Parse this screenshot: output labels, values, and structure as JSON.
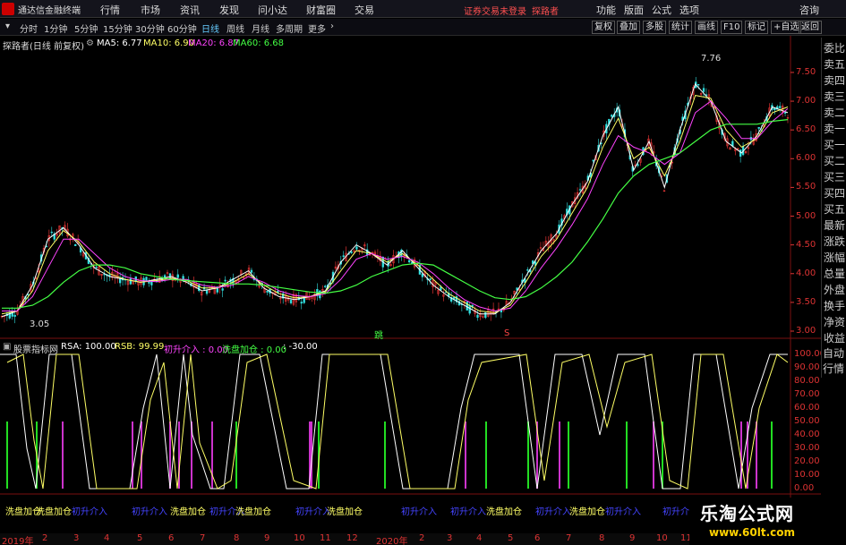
{
  "menubar": {
    "app_title": "通达信金融终端",
    "items": [
      "行情",
      "市场",
      "资讯",
      "发现",
      "问小达",
      "财富圈",
      "交易"
    ],
    "notice": "证券交易未登录",
    "user": "探路者",
    "right_items": [
      "功能",
      "版面",
      "公式",
      "选项",
      "咨询"
    ]
  },
  "toolbar": {
    "periods": [
      "分时",
      "1分钟",
      "5分钟",
      "15分钟",
      "30分钟",
      "60分钟",
      "日线",
      "周线",
      "月线",
      "多周期",
      "更多"
    ],
    "active_period": "日线",
    "right_buttons": [
      "复权",
      "叠加",
      "多股",
      "统计",
      "画线",
      "F10",
      "标记",
      "+自选",
      "返回"
    ]
  },
  "main_chart": {
    "title": "探路者(日线 前复权)",
    "ma": [
      {
        "label": "MA5: 6.77",
        "color": "#ffffff"
      },
      {
        "label": "MA10: 6.90",
        "color": "#ffff66"
      },
      {
        "label": "MA20: 6.87",
        "color": "#ff44ff"
      },
      {
        "label": "MA60: 6.68",
        "color": "#44ff44"
      }
    ],
    "y_ticks": [
      "7.50",
      "7.00",
      "6.50",
      "6.00",
      "5.50",
      "5.00",
      "4.50",
      "4.00",
      "3.50",
      "3.00"
    ],
    "high_label": "7.76",
    "low_label": "3.05",
    "marker_green": "跳",
    "marker_red": "S"
  },
  "indicator": {
    "title": "股票指标网",
    "params": [
      {
        "label": "RSA: 100.00",
        "color": "#ffffff"
      },
      {
        "label": "RSB: 99.99",
        "color": "#ffff66"
      },
      {
        "label": "初升介入 : 0.00",
        "color": "#ff44ff"
      },
      {
        "label": "洗盘加仓 : 0.00",
        "color": "#44ff44"
      },
      {
        "label": ": -30.00",
        "color": "#ffffff"
      }
    ],
    "y_ticks": [
      "100.00",
      "90.00",
      "80.00",
      "70.00",
      "60.00",
      "50.00",
      "40.00",
      "30.00",
      "20.00",
      "10.00",
      "0.00"
    ]
  },
  "signals": [
    {
      "text": "洗盘加仓",
      "color": "#ffff66"
    },
    {
      "text": "洗盘加仓",
      "color": "#ffff66"
    },
    {
      "text": "初升介入",
      "color": "#4444ff"
    },
    {
      "text": "初升介入",
      "color": "#4444ff"
    },
    {
      "text": "洗盘加仓",
      "color": "#ffff66"
    },
    {
      "text": "初升介入",
      "color": "#4444ff"
    },
    {
      "text": "洗盘加仓",
      "color": "#ffff66"
    },
    {
      "text": "初升介入",
      "color": "#4444ff"
    },
    {
      "text": "洗盘加仓",
      "color": "#ffff66"
    },
    {
      "text": "初升介入",
      "color": "#4444ff"
    },
    {
      "text": "初升介入",
      "color": "#4444ff"
    },
    {
      "text": "洗盘加仓",
      "color": "#ffff66"
    },
    {
      "text": "初升介入",
      "color": "#4444ff"
    },
    {
      "text": "洗盘加仓",
      "color": "#ffff66"
    },
    {
      "text": "初升介入",
      "color": "#4444ff"
    },
    {
      "text": "初升介入",
      "color": "#4444ff"
    }
  ],
  "dates": [
    "2019年",
    "2",
    "3",
    "4",
    "5",
    "6",
    "7",
    "8",
    "9",
    "10",
    "11",
    "12",
    "2020年",
    "2",
    "3",
    "4",
    "5",
    "6",
    "7",
    "8",
    "9",
    "10",
    "11"
  ],
  "side_panel": [
    "委比",
    "卖五",
    "卖四",
    "卖三",
    "卖二",
    "卖一",
    "买一",
    "买二",
    "买三",
    "买四",
    "买五",
    "最新",
    "涨跌",
    "涨幅",
    "总量",
    "外盘",
    "换手",
    "净资",
    "收益"
  ],
  "side_panel_bottom": [
    "自动",
    "行情"
  ],
  "watermark": {
    "cn": "乐淘公式网",
    "url": "www.60lt.com"
  },
  "chart_data": {
    "type": "candlestick",
    "series": [
      {
        "name": "MA5",
        "values": [
          3.25,
          3.35,
          3.8,
          4.6,
          4.8,
          4.5,
          4.1,
          3.95,
          3.9,
          3.85,
          3.9,
          3.95,
          3.85,
          3.7,
          3.75,
          3.9,
          4.05,
          3.75,
          3.6,
          3.55,
          3.6,
          3.7,
          4.2,
          4.5,
          4.35,
          4.15,
          4.4,
          4.1,
          3.8,
          3.6,
          3.45,
          3.3,
          3.3,
          3.5,
          3.95,
          4.4,
          4.7,
          5.2,
          5.6,
          6.4,
          6.9,
          5.8,
          6.3,
          5.5,
          6.5,
          7.3,
          7.0,
          6.3,
          6.1,
          6.4,
          6.9,
          6.8
        ]
      },
      {
        "name": "MA10",
        "values": [
          3.3,
          3.35,
          3.7,
          4.4,
          4.75,
          4.55,
          4.2,
          4.0,
          3.9,
          3.85,
          3.88,
          3.92,
          3.88,
          3.75,
          3.75,
          3.85,
          4.0,
          3.8,
          3.65,
          3.58,
          3.6,
          3.68,
          4.05,
          4.4,
          4.35,
          4.2,
          4.35,
          4.15,
          3.9,
          3.65,
          3.5,
          3.35,
          3.32,
          3.45,
          3.85,
          4.3,
          4.6,
          5.05,
          5.5,
          6.2,
          6.7,
          6.0,
          6.2,
          5.7,
          6.3,
          7.1,
          7.05,
          6.5,
          6.2,
          6.35,
          6.8,
          6.9
        ]
      },
      {
        "name": "MA20",
        "values": [
          3.35,
          3.35,
          3.6,
          4.1,
          4.6,
          4.6,
          4.35,
          4.1,
          3.95,
          3.88,
          3.86,
          3.9,
          3.9,
          3.8,
          3.76,
          3.8,
          3.95,
          3.85,
          3.7,
          3.62,
          3.6,
          3.65,
          3.9,
          4.25,
          4.35,
          4.25,
          4.3,
          4.2,
          4.0,
          3.75,
          3.55,
          3.42,
          3.35,
          3.4,
          3.7,
          4.1,
          4.45,
          4.85,
          5.3,
          5.9,
          6.4,
          6.2,
          6.1,
          5.9,
          6.1,
          6.8,
          7.0,
          6.7,
          6.35,
          6.35,
          6.65,
          6.87
        ]
      },
      {
        "name": "MA60",
        "values": [
          3.4,
          3.4,
          3.45,
          3.6,
          3.85,
          4.05,
          4.15,
          4.15,
          4.1,
          4.0,
          3.95,
          3.9,
          3.88,
          3.86,
          3.84,
          3.82,
          3.82,
          3.8,
          3.76,
          3.72,
          3.68,
          3.66,
          3.7,
          3.8,
          3.95,
          4.05,
          4.15,
          4.18,
          4.15,
          4.0,
          3.85,
          3.7,
          3.58,
          3.55,
          3.6,
          3.75,
          3.95,
          4.2,
          4.55,
          4.95,
          5.4,
          5.7,
          5.9,
          6.0,
          6.1,
          6.3,
          6.5,
          6.6,
          6.6,
          6.6,
          6.65,
          6.68
        ]
      }
    ],
    "ylim": [
      3.0,
      7.76
    ]
  }
}
